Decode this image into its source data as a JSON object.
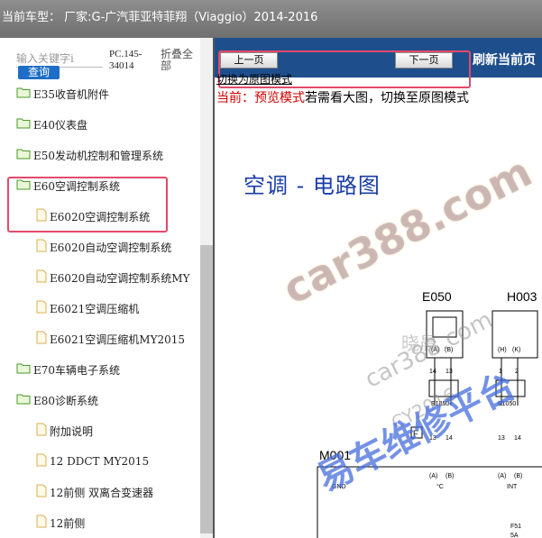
{
  "header": {
    "title": "当前车型： 厂家:G-广汽菲亚特菲翔（Viaggio）2014-2016"
  },
  "left_panel": {
    "search_placeholder": "输入关键字i",
    "query_label": "查询",
    "pc_code": "PC.145-34014",
    "collapse_all": "折叠全部",
    "tree": [
      {
        "label": "E35收音机附件",
        "type": "folder",
        "level": 0
      },
      {
        "label": "E40仪表盘",
        "type": "folder",
        "level": 0
      },
      {
        "label": "E50发动机控制和管理系统",
        "type": "folder",
        "level": 0
      },
      {
        "label": "E60空调控制系统",
        "type": "folder",
        "level": 0
      },
      {
        "label": "E6020空调控制系统",
        "type": "file",
        "level": 1
      },
      {
        "label": "E6020自动空调控制系统",
        "type": "file",
        "level": 1
      },
      {
        "label": "E6020自动空调控制系统MY",
        "type": "file",
        "level": 1
      },
      {
        "label": "E6021空调压缩机",
        "type": "file",
        "level": 1
      },
      {
        "label": "E6021空调压缩机MY2015",
        "type": "file",
        "level": 1
      },
      {
        "label": "E70车辆电子系统",
        "type": "folder",
        "level": 0
      },
      {
        "label": "E80诊断系统",
        "type": "folder",
        "level": 0
      },
      {
        "label": "附加说明",
        "type": "file",
        "level": 1
      },
      {
        "label": "12 DDCT MY2015",
        "type": "file",
        "level": 1
      },
      {
        "label": "12前侧 双离合变速器",
        "type": "file",
        "level": 1
      },
      {
        "label": "12前侧",
        "type": "file",
        "level": 1
      }
    ]
  },
  "toolbar": {
    "prev_label": "上一页",
    "next_label": "下一页",
    "refresh_label": "刷新当前页"
  },
  "content": {
    "original_link": "切换为原图模式",
    "mode_prefix": "当前：预览模式",
    "mode_suffix": "若需看大图，切换至原图模式",
    "page_title": "空调 - 电路图"
  },
  "diagram": {
    "connectors": [
      "E050",
      "H003",
      "M001",
      "E1050",
      "E1050"
    ],
    "pins_left": [
      "14",
      "13"
    ],
    "pins_right": [
      "1",
      "2"
    ],
    "pins_bottom": [
      "13",
      "14"
    ],
    "pin_tags_top": [
      "(A)",
      "(B)",
      "(H)",
      "(K)"
    ],
    "pin_tags_bottom": [
      "(A)",
      "(B)",
      "(A)",
      "(B)"
    ],
    "labels": [
      "GND",
      "°C",
      "INT"
    ],
    "fuse_box": "F",
    "fuse": "F51",
    "fuse_rating": "5A"
  },
  "watermarks": [
    "car388.com",
    "car388.com",
    "CY2016",
    "易车维修平台",
    "晓晨"
  ],
  "colors": {
    "accent": "#1e4f8c",
    "highlight": "#e24a6a",
    "title_blue": "#1a3da8",
    "watermark_blue": "#466edc"
  }
}
